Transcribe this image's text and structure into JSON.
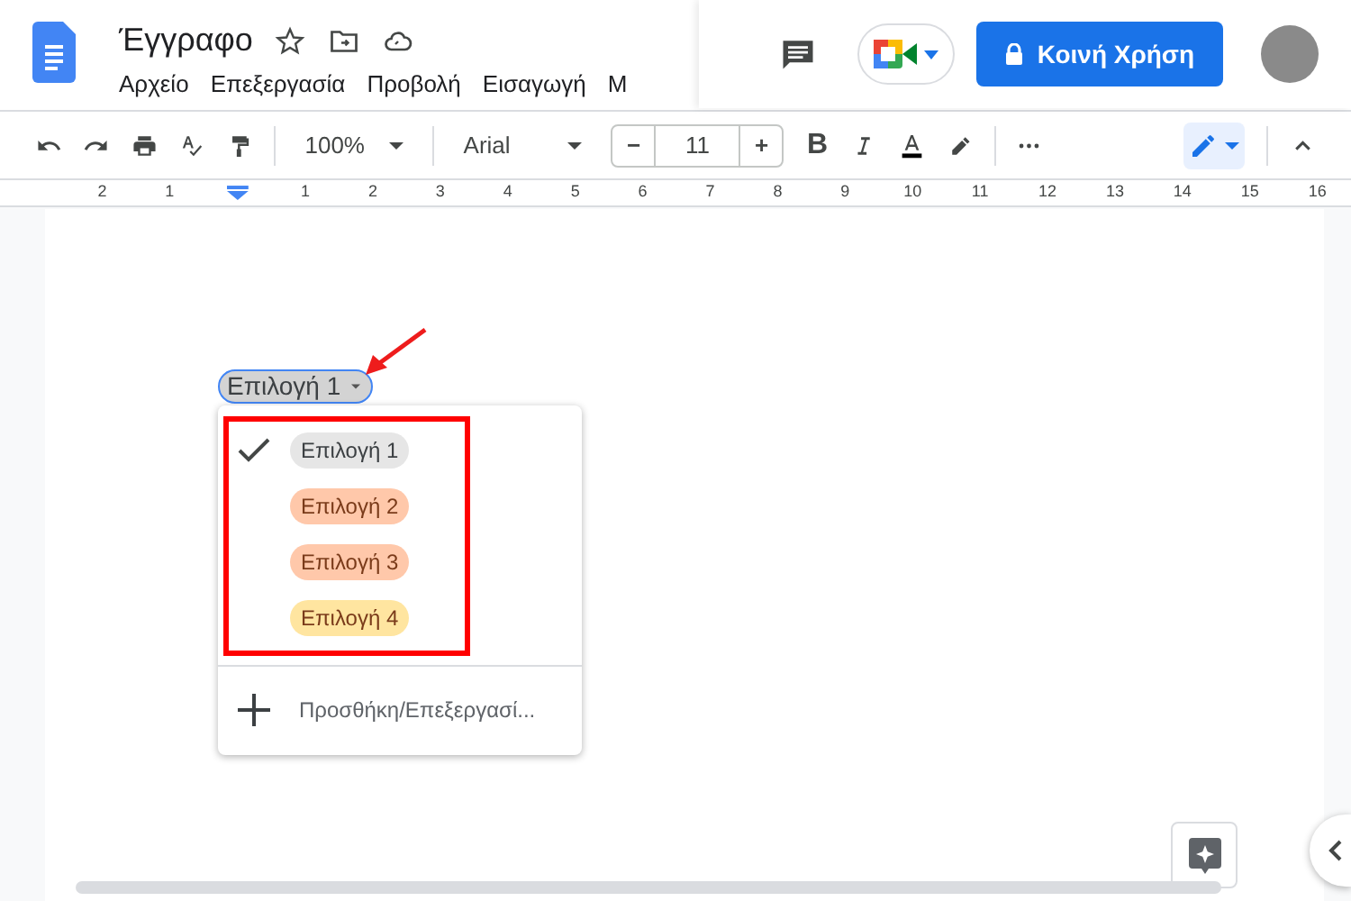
{
  "document": {
    "title": "Έγγραφο"
  },
  "menu": [
    "Αρχείο",
    "Επεξεργασία",
    "Προβολή",
    "Εισαγωγή",
    "Μ"
  ],
  "share_button": {
    "label": "Κοινή Χρήση"
  },
  "toolbar": {
    "bold": "B",
    "zoom": "100%",
    "font": "Arial",
    "font_size": "11",
    "minus": "−",
    "plus": "+"
  },
  "ruler": [
    {
      "kind": "number",
      "label": "2"
    },
    {
      "kind": "number",
      "label": "1"
    },
    {
      "kind": "indent"
    },
    {
      "kind": "number",
      "label": "1"
    },
    {
      "kind": "number",
      "label": "2"
    },
    {
      "kind": "number",
      "label": "3"
    },
    {
      "kind": "number",
      "label": "4"
    },
    {
      "kind": "number",
      "label": "5"
    },
    {
      "kind": "number",
      "label": "6"
    },
    {
      "kind": "number",
      "label": "7"
    },
    {
      "kind": "number",
      "label": "8"
    },
    {
      "kind": "number",
      "label": "9"
    },
    {
      "kind": "number",
      "label": "10"
    },
    {
      "kind": "number",
      "label": "11"
    },
    {
      "kind": "number",
      "label": "12"
    },
    {
      "kind": "number",
      "label": "13"
    },
    {
      "kind": "number",
      "label": "14"
    },
    {
      "kind": "number",
      "label": "15"
    },
    {
      "kind": "number",
      "label": "16"
    }
  ],
  "dropdown_chip": {
    "label": "Επιλογή 1"
  },
  "options": [
    {
      "label": "Επιλογή 1",
      "selected": true,
      "color": "#e6e6e6"
    },
    {
      "label": "Επιλογή 2",
      "selected": false,
      "color": "#ffc8aa"
    },
    {
      "label": "Επιλογή 3",
      "selected": false,
      "color": "#ffc8aa"
    },
    {
      "label": "Επιλογή 4",
      "selected": false,
      "color": "#ffe5a0"
    }
  ],
  "add_option": "Προσθήκη/Επεξεργασί..."
}
